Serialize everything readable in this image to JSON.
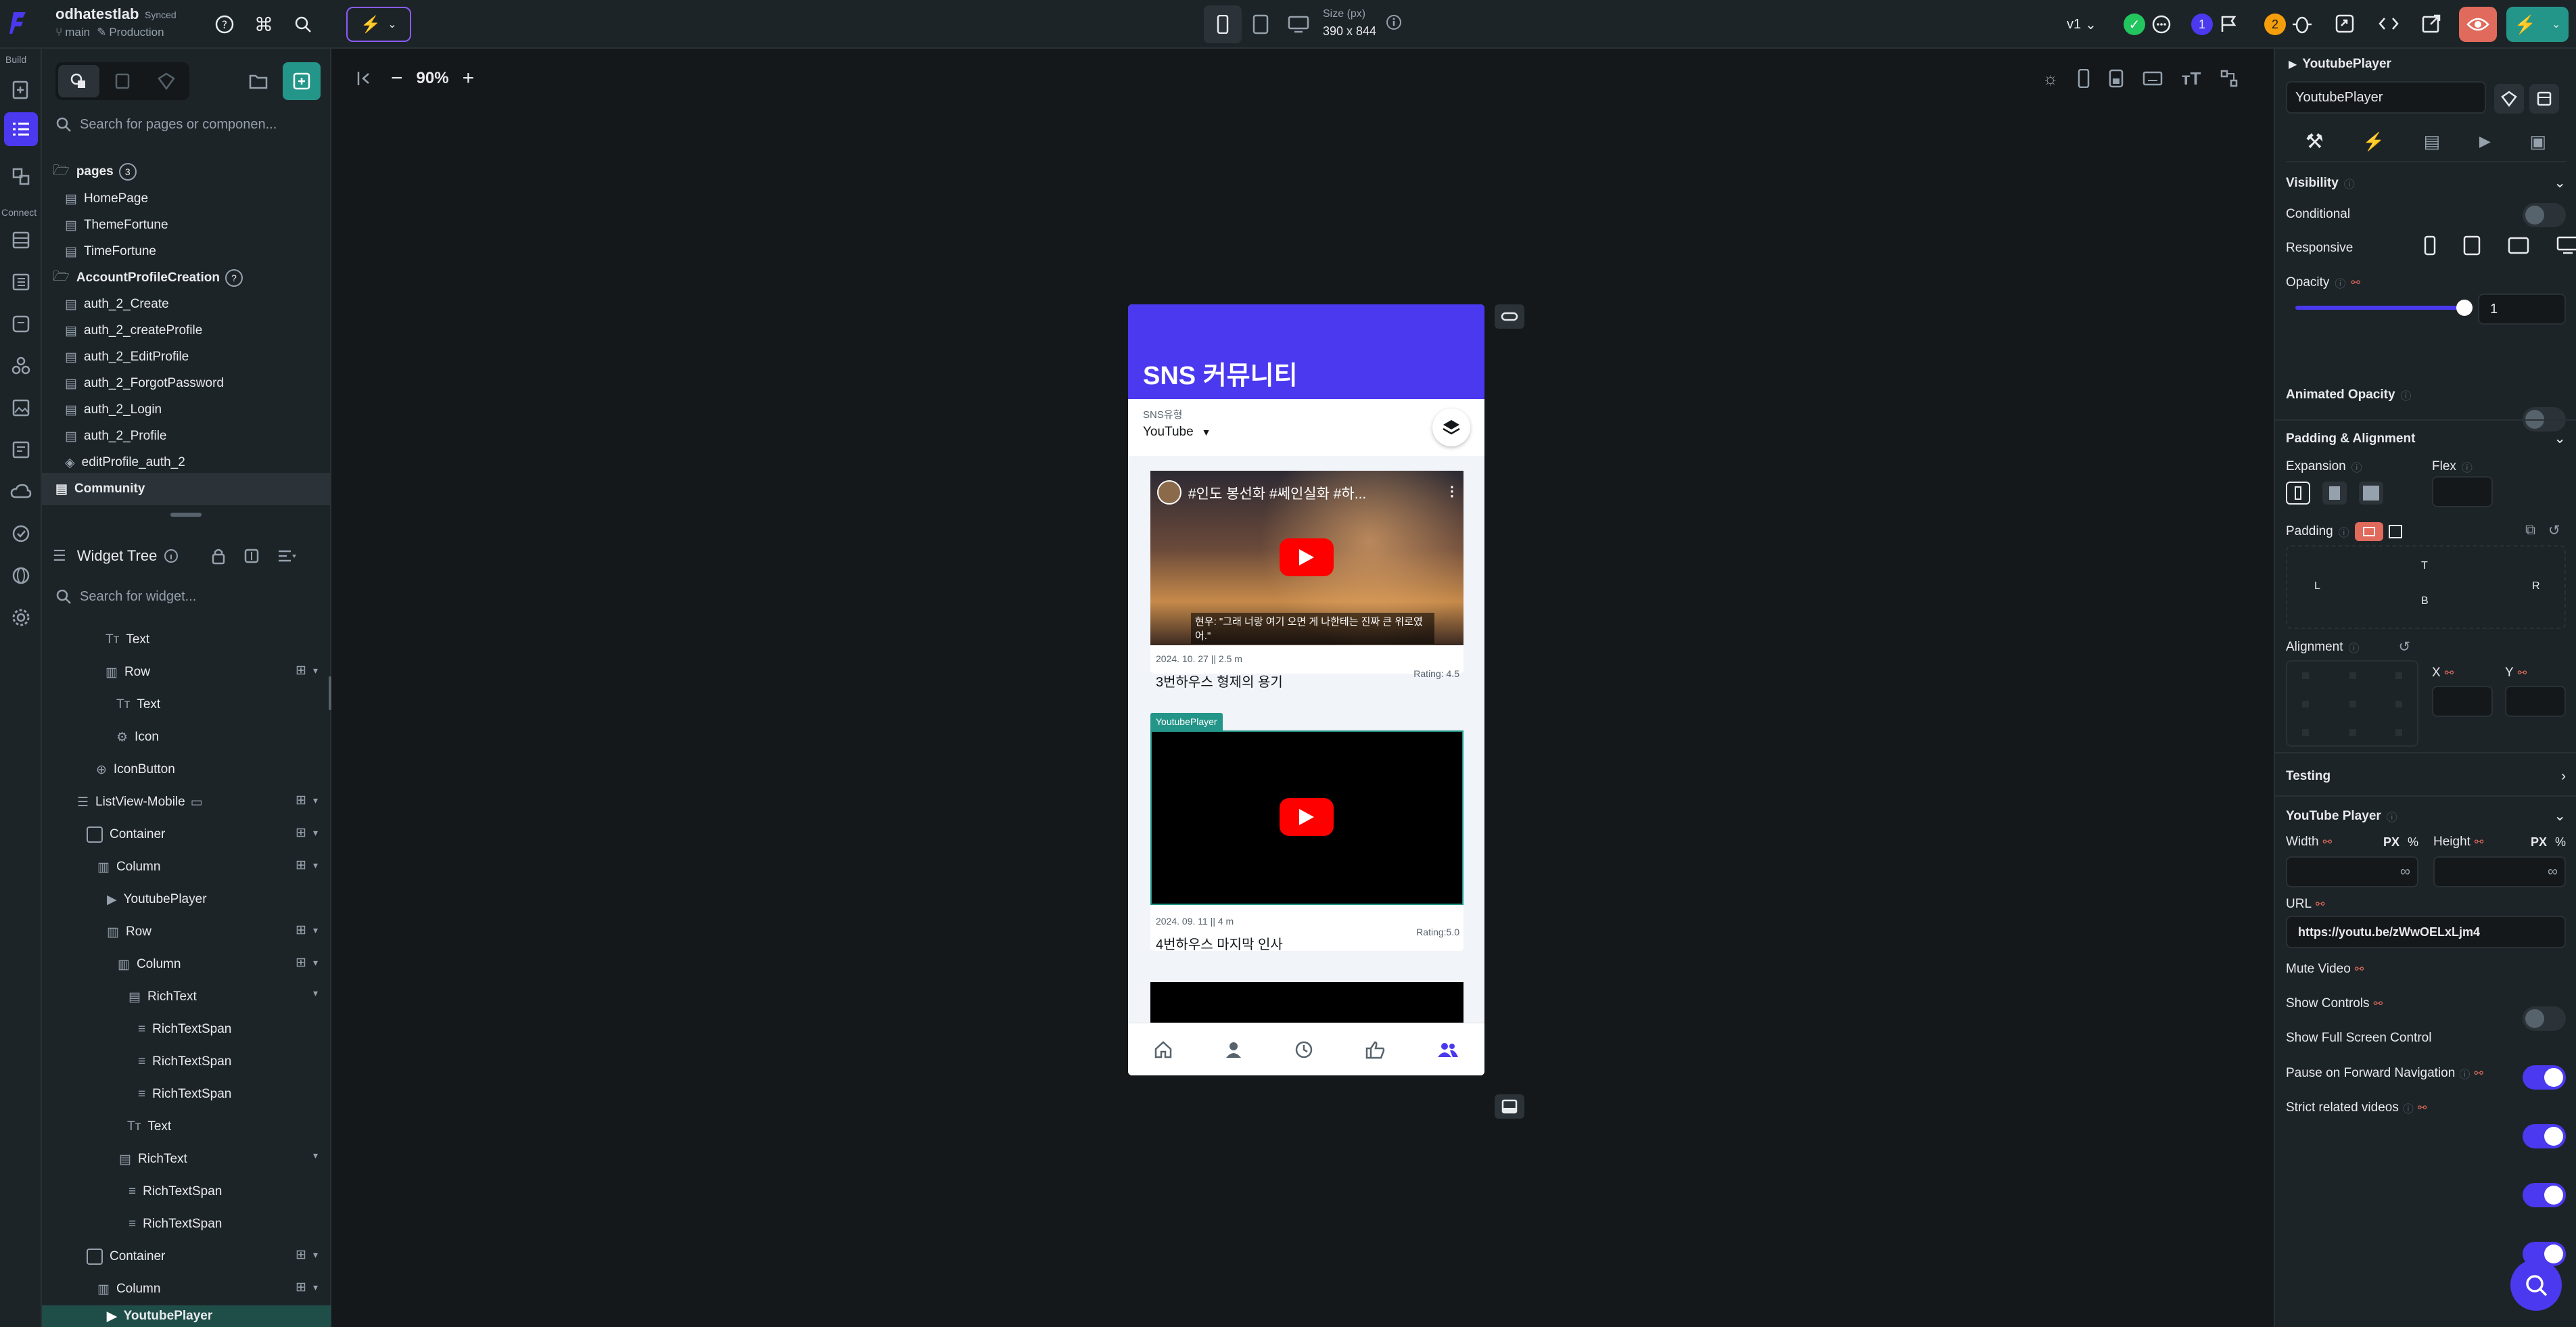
{
  "colors": {
    "accent": "#4b39ef",
    "green": "#249689",
    "bg": "#14181b",
    "panel": "#1d2428"
  },
  "topbar": {
    "project_name": "odhatestlab",
    "sync_status": "Synced",
    "branch": "main",
    "environment": "Production",
    "size_label": "Size (px)",
    "size_value": "390 x 844",
    "version": "v1",
    "badge_blue": "1",
    "badge_orange": "2"
  },
  "rail": {
    "build_label": "Build",
    "connect_label": "Connect"
  },
  "left": {
    "search_placeholder": "Search for pages or componen...",
    "pages_header": "pages",
    "pages_count": "3",
    "pages": [
      "HomePage",
      "ThemeFortune",
      "TimeFortune"
    ],
    "folder_name": "AccountProfileCreation",
    "folder_pages": [
      "auth_2_Create",
      "auth_2_createProfile",
      "auth_2_EditProfile",
      "auth_2_ForgotPassword",
      "auth_2_Login",
      "auth_2_Profile",
      "editProfile_auth_2"
    ],
    "selected_page": "Community",
    "widget_tree_title": "Widget Tree",
    "widget_search_placeholder": "Search for widget...",
    "tree": [
      "Text",
      "Row",
      "Text",
      "Icon",
      "IconButton",
      "ListView-Mobile",
      "Container",
      "Column",
      "YoutubePlayer",
      "Row",
      "Column",
      "RichText",
      "RichTextSpan",
      "RichTextSpan",
      "RichTextSpan",
      "Text",
      "RichText",
      "RichTextSpan",
      "RichTextSpan",
      "Container",
      "Column",
      "YoutubePlayer"
    ]
  },
  "canvas": {
    "zoom": "90%"
  },
  "phone": {
    "title": "SNS 커뮤니티",
    "filter_label": "SNS유형",
    "filter_value": "YouTube",
    "card1": {
      "video_title": "#인도 봉선화 #쎄인실화 #하...",
      "caption": "현우: \"그래 너랑 여기 오면 게 나한테는 진짜 큰 위로였어.\"",
      "meta": "2024. 10. 27 || 2.5 m",
      "name": "3번하우스 형제의 용기",
      "rating": "Rating: 4.5"
    },
    "selected_tag": "YoutubePlayer",
    "card2": {
      "meta": "2024. 09. 11 || 4 m",
      "name": "4번하우스 마지막 인사",
      "rating": "Rating:5.0"
    }
  },
  "right": {
    "widget_type": "YoutubePlayer",
    "widget_name": "YoutubePlayer",
    "visibility": "Visibility",
    "conditional": "Conditional",
    "responsive": "Responsive",
    "opacity": "Opacity",
    "opacity_value": "1",
    "opacity_level": 1,
    "animated_opacity": "Animated Opacity",
    "padding_alignment": "Padding & Alignment",
    "expansion": "Expansion",
    "flex": "Flex",
    "padding": "Padding",
    "pad_t": "T",
    "pad_l": "L",
    "pad_r": "R",
    "pad_b": "B",
    "alignment": "Alignment",
    "align_x": "X",
    "align_y": "Y",
    "testing": "Testing",
    "youtube_player": "YouTube Player",
    "width": "Width",
    "height": "Height",
    "px": "PX",
    "pct": "%",
    "infinity": "∞",
    "url_label": "URL",
    "url_value": "https://youtu.be/zWwOELxLjm4",
    "mute_video": "Mute Video",
    "show_controls": "Show Controls",
    "show_fullscreen": "Show Full Screen Control",
    "pause_on_forward": "Pause on Forward Navigation",
    "strict_related": "Strict related videos"
  }
}
